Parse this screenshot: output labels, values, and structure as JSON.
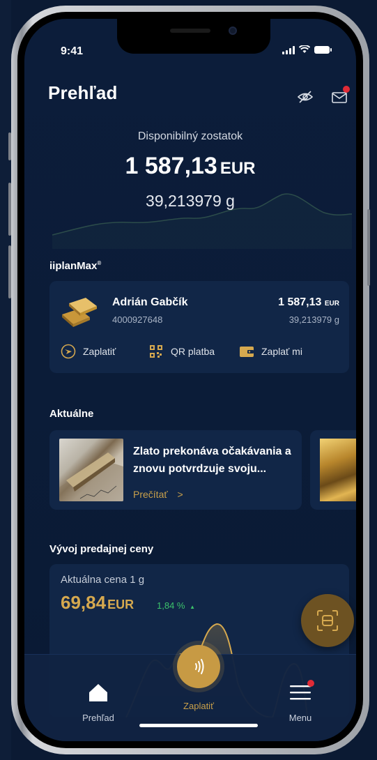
{
  "status": {
    "time": "9:41"
  },
  "header": {
    "title": "Prehľad",
    "eye_icon": "eye-off-icon",
    "mail_icon": "mail-icon"
  },
  "balance": {
    "label": "Disponibilný zostatok",
    "amount": "1 587,13",
    "currency": "EUR",
    "grams": "39,213979 g"
  },
  "account_section": {
    "title": "iiplanMax",
    "mark": "®"
  },
  "account": {
    "name": "Adrián Gabčík",
    "number": "4000927648",
    "amount": "1 587,13",
    "currency": "EUR",
    "grams": "39,213979 g",
    "actions": [
      {
        "label": "Zaplatiť",
        "icon": "send-icon"
      },
      {
        "label": "QR platba",
        "icon": "qr-code-icon"
      },
      {
        "label": "Zaplať mi",
        "icon": "wallet-icon"
      }
    ]
  },
  "news_section": {
    "title": "Aktuálne"
  },
  "news": [
    {
      "title": "Zlato prekonáva očakávania a znovu potvrdzuje svoju...",
      "read_label": "Prečítať",
      "read_arrow": ">"
    }
  ],
  "price_section": {
    "title": "Vývoj predajnej ceny"
  },
  "price": {
    "label": "Aktuálna cena 1 g",
    "value": "69,84",
    "currency": "EUR",
    "change": "1,84 %",
    "change_arrow": "▲"
  },
  "tabs": [
    {
      "label": "Prehľad",
      "icon": "home-icon"
    },
    {
      "label": "Zaplatiť",
      "icon": "contactless-icon"
    },
    {
      "label": "Menu",
      "icon": "menu-icon"
    }
  ],
  "colors": {
    "gold": "#c79a44",
    "background": "#0c1d3a",
    "card": "#112647",
    "positive": "#3cc26b",
    "badge": "#e12b36"
  }
}
